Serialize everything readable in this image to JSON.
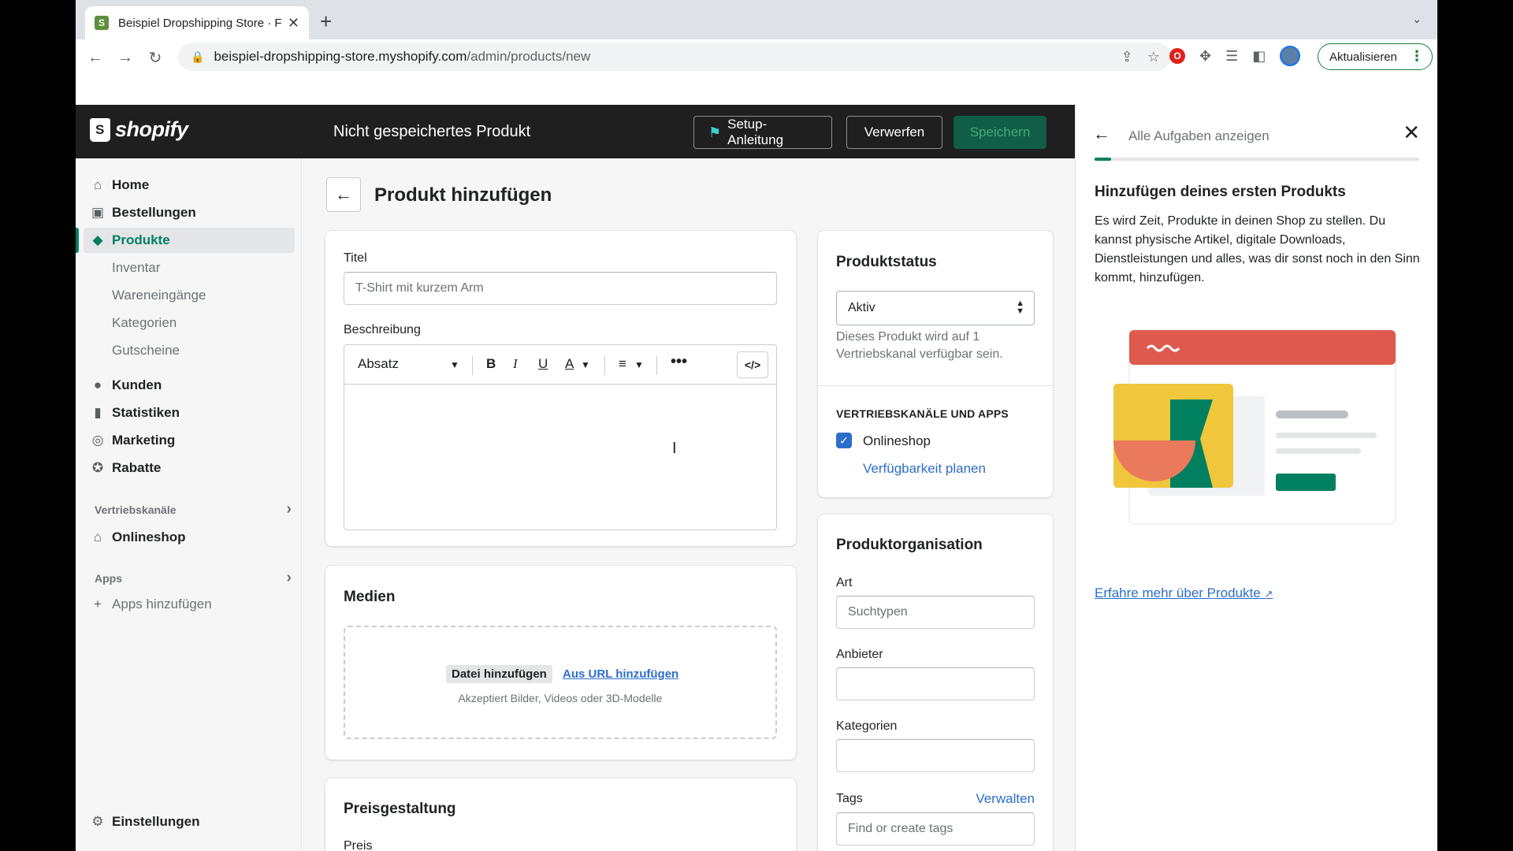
{
  "browser": {
    "tab_title": "Beispiel Dropshipping Store · F",
    "url_host": "beispiel-dropshipping-store.myshopify.com",
    "url_path": "/admin/products/new",
    "update_label": "Aktualisieren"
  },
  "topbar": {
    "logo_text": "shopify",
    "page_state": "Nicht gespeichertes Produkt",
    "setup_label": "Setup-Anleitung",
    "discard_label": "Verwerfen",
    "save_label": "Speichern"
  },
  "sidebar": {
    "items": [
      {
        "label": "Home",
        "icon": "home-icon"
      },
      {
        "label": "Bestellungen",
        "icon": "orders-icon"
      },
      {
        "label": "Produkte",
        "icon": "tag-icon"
      },
      {
        "label": "Inventar"
      },
      {
        "label": "Wareneingänge"
      },
      {
        "label": "Kategorien"
      },
      {
        "label": "Gutscheine"
      },
      {
        "label": "Kunden",
        "icon": "person-icon"
      },
      {
        "label": "Statistiken",
        "icon": "bar-chart-icon"
      },
      {
        "label": "Marketing",
        "icon": "target-icon"
      },
      {
        "label": "Rabatte",
        "icon": "discount-icon"
      }
    ],
    "channels_heading": "Vertriebskanäle",
    "onlineshop": "Onlineshop",
    "apps_heading": "Apps",
    "add_apps": "Apps hinzufügen",
    "settings": "Einstellungen"
  },
  "main": {
    "page_title": "Produkt hinzufügen",
    "title_label": "Titel",
    "title_placeholder": "T-Shirt mit kurzem Arm",
    "description_label": "Beschreibung",
    "paragraph_select": "Absatz",
    "media_heading": "Medien",
    "add_file": "Datei hinzufügen",
    "add_from_url": "Aus URL hinzufügen",
    "media_help": "Akzeptiert Bilder, Videos oder 3D-Modelle",
    "pricing_heading": "Preisgestaltung",
    "price_label": "Preis"
  },
  "status": {
    "heading": "Produktstatus",
    "value": "Aktiv",
    "help_line1": "Dieses Produkt wird auf 1",
    "help_line2": "Vertriebskanal verfügbar sein.",
    "channels_heading": "VERTRIEBSKANÄLE UND APPS",
    "channel": "Onlineshop",
    "schedule_link": "Verfügbarkeit planen"
  },
  "organization": {
    "heading": "Produktorganisation",
    "type_label": "Art",
    "type_placeholder": "Suchtypen",
    "vendor_label": "Anbieter",
    "categories_label": "Kategorien",
    "tags_label": "Tags",
    "manage_link": "Verwalten",
    "tags_placeholder": "Find or create tags"
  },
  "panel": {
    "back_text": "Alle Aufgaben anzeigen",
    "progress": 0.05,
    "heading": "Hinzufügen deines ersten Produkts",
    "body": "Es wird Zeit, Produkte in deinen Shop zu stellen. Du kannst physische Artikel, digitale Downloads, Dienstleistungen und alles, was dir sonst noch in den Sinn kommt, hinzufügen.",
    "learn_more": "Erfahre mehr über Produkte"
  },
  "colors": {
    "shopify_green": "#008060",
    "topbar_bg": "#1f1f1f",
    "link_blue": "#2c6ecb",
    "illustration_red": "#de5a4e",
    "illustration_yellow": "#f0c63d"
  }
}
